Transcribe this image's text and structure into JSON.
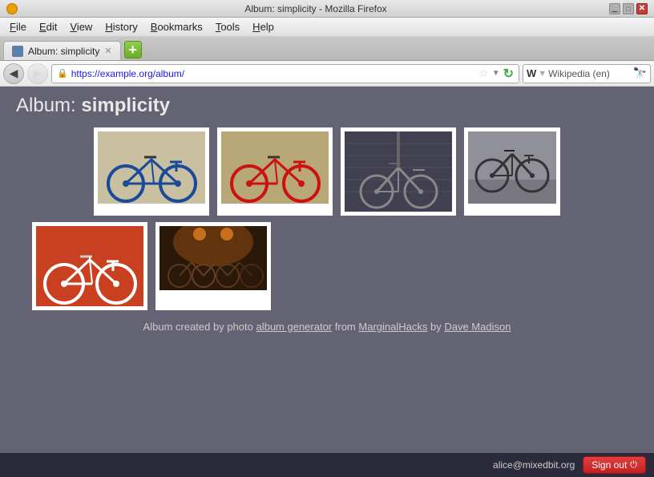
{
  "titleBar": {
    "title": "Album: simplicity - Mozilla Firefox"
  },
  "menuBar": {
    "items": [
      {
        "id": "file",
        "label": "File",
        "underlineChar": "F"
      },
      {
        "id": "edit",
        "label": "Edit",
        "underlineChar": "E"
      },
      {
        "id": "view",
        "label": "View",
        "underlineChar": "V"
      },
      {
        "id": "history",
        "label": "History",
        "underlineChar": "H"
      },
      {
        "id": "bookmarks",
        "label": "Bookmarks",
        "underlineChar": "B"
      },
      {
        "id": "tools",
        "label": "Tools",
        "underlineChar": "T"
      },
      {
        "id": "help",
        "label": "Help",
        "underlineChar": "H"
      }
    ]
  },
  "tabBar": {
    "tabs": [
      {
        "id": "album-tab",
        "label": "Album: simplicity"
      }
    ],
    "addButton": "+"
  },
  "navBar": {
    "backButton": "◀",
    "addressBar": {
      "url": "https://example.org/album/",
      "lockIcon": "🔒"
    },
    "searchBar": {
      "placeholder": "Wikipedia (en)",
      "logoText": "W"
    }
  },
  "page": {
    "albumTitle": "Album:",
    "albumName": "simplicity",
    "photos": [
      {
        "id": "photo-1",
        "alt": "Blue bicycle",
        "row": 1,
        "col": 1,
        "bgColor": "#c8c0a8",
        "frameColor": "#fff"
      },
      {
        "id": "photo-2",
        "alt": "Red bicycle",
        "row": 1,
        "col": 2,
        "bgColor": "#b8a888",
        "frameColor": "#fff"
      },
      {
        "id": "photo-3",
        "alt": "Gray bicycle against wall",
        "row": 1,
        "col": 3,
        "bgColor": "#404048",
        "frameColor": "#fff"
      },
      {
        "id": "photo-4",
        "alt": "Black and white bicycle",
        "row": 1,
        "col": 4,
        "bgColor": "#a0a0a8",
        "frameColor": "#fff"
      },
      {
        "id": "photo-5",
        "alt": "White bicycle on orange",
        "row": 2,
        "col": 1,
        "bgColor": "#c84020",
        "frameColor": "#fff"
      },
      {
        "id": "photo-6",
        "alt": "Bicycles in dark room",
        "row": 2,
        "col": 2,
        "bgColor": "#483020",
        "frameColor": "#fff"
      }
    ],
    "footer": {
      "text1": "Album created by photo ",
      "link1": "album generator",
      "text2": " from ",
      "link2": "MarginalHacks",
      "text3": " by ",
      "link3": "Dave Madison"
    }
  },
  "bottomBar": {
    "email": "alice@mixedbit.org",
    "signOutLabel": "Sign out"
  }
}
